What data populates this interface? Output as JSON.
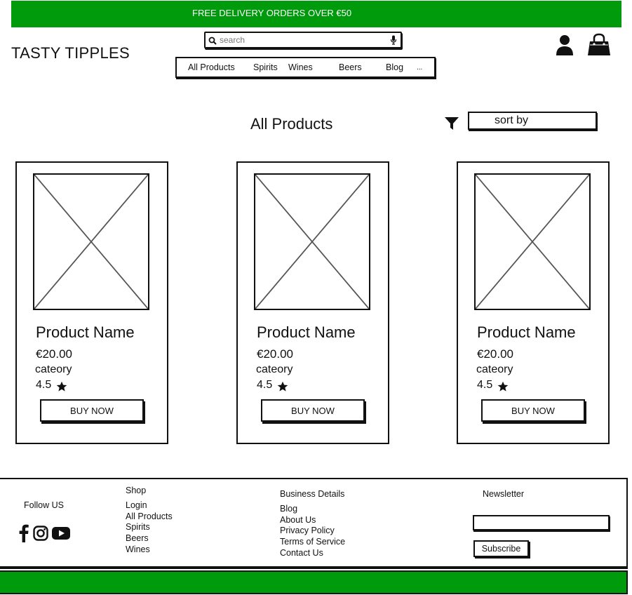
{
  "banner": {
    "text": "FREE DELIVERY ORDERS OVER €50",
    "color": "#009a0d"
  },
  "header": {
    "logo": "TASTY TIPPLES",
    "search": {
      "placeholder": "search",
      "value": ""
    },
    "icons": {
      "search": "search-icon",
      "mic": "microphone-icon",
      "account": "user-icon",
      "cart": "shopping-bag-icon"
    },
    "nav": [
      "All Products",
      "Spirits",
      "Wines",
      "Beers",
      "Blog",
      "..."
    ]
  },
  "main": {
    "title": "All Products",
    "sort_label": "sort by",
    "filter_icon": "filter-icon",
    "products": [
      {
        "name": "Product Name",
        "price": "€20.00",
        "category": "cateory",
        "rating": "4.5",
        "button": "BUY NOW"
      },
      {
        "name": "Product Name",
        "price": "€20.00",
        "category": "cateory",
        "rating": "4.5",
        "button": "BUY NOW"
      },
      {
        "name": "Product Name",
        "price": "€20.00",
        "category": "cateory",
        "rating": "4.5",
        "button": "BUY NOW"
      }
    ]
  },
  "footer": {
    "follow": "Follow US",
    "social_icons": [
      "facebook-icon",
      "instagram-icon",
      "youtube-icon"
    ],
    "shop": {
      "heading": "Shop",
      "links": [
        "Login",
        "All Products",
        "Spirits",
        "Beers",
        "Wines"
      ]
    },
    "business": {
      "heading": "Business Details",
      "links": [
        "Blog",
        "About Us",
        "Privacy Policy",
        "Terms of Service",
        "Contact Us"
      ]
    },
    "newsletter": {
      "heading": "Newsletter",
      "input_value": "",
      "button": "Subscribe"
    }
  }
}
